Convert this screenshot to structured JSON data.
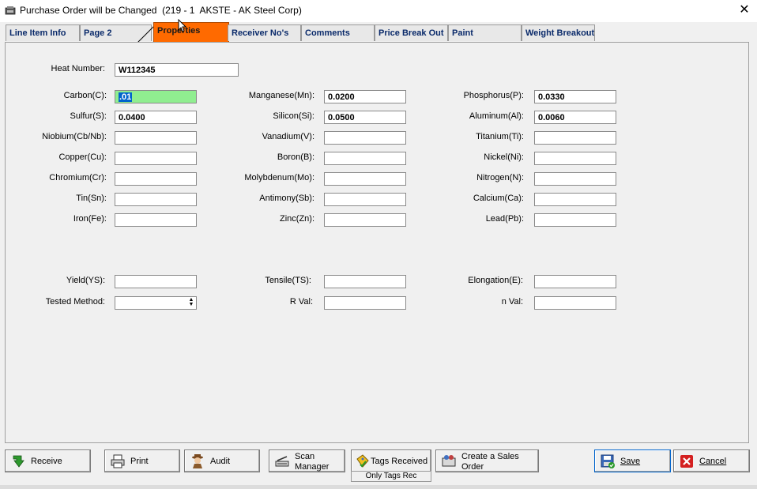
{
  "window": {
    "title": "Purchase Order will be Changed  (219 - 1  AKSTE - AK Steel Corp)",
    "close_glyph": "✕"
  },
  "tabs": [
    {
      "label": "Line Item Info",
      "active": false
    },
    {
      "label": "Page 2",
      "active": false
    },
    {
      "label": "Properties",
      "active": true
    },
    {
      "label": "Receiver No's",
      "active": false
    },
    {
      "label": "Comments",
      "active": false
    },
    {
      "label": "Price Break Out",
      "active": false
    },
    {
      "label": "Paint",
      "active": false
    },
    {
      "label": "Weight Breakout",
      "active": false
    }
  ],
  "heat": {
    "label": "Heat Number:",
    "value": "W112345"
  },
  "elements": {
    "col1": [
      {
        "label": "Carbon(C):",
        "value": ".01"
      },
      {
        "label": "Sulfur(S):",
        "value": "0.0400"
      },
      {
        "label": "Niobium(Cb/Nb):",
        "value": ""
      },
      {
        "label": "Copper(Cu):",
        "value": ""
      },
      {
        "label": "Chromium(Cr):",
        "value": ""
      },
      {
        "label": "Tin(Sn):",
        "value": ""
      },
      {
        "label": "Iron(Fe):",
        "value": ""
      }
    ],
    "col2": [
      {
        "label": "Manganese(Mn):",
        "value": "0.0200"
      },
      {
        "label": "Silicon(Si):",
        "value": "0.0500"
      },
      {
        "label": "Vanadium(V):",
        "value": ""
      },
      {
        "label": "Boron(B):",
        "value": ""
      },
      {
        "label": "Molybdenum(Mo):",
        "value": ""
      },
      {
        "label": "Antimony(Sb):",
        "value": ""
      },
      {
        "label": "Zinc(Zn):",
        "value": ""
      }
    ],
    "col3": [
      {
        "label": "Phosphorus(P):",
        "value": "0.0330"
      },
      {
        "label": "Aluminum(Al):",
        "value": "0.0060"
      },
      {
        "label": "Titanium(Ti):",
        "value": ""
      },
      {
        "label": "Nickel(Ni):",
        "value": ""
      },
      {
        "label": "Nitrogen(N):",
        "value": ""
      },
      {
        "label": "Calcium(Ca):",
        "value": ""
      },
      {
        "label": "Lead(Pb):",
        "value": ""
      }
    ]
  },
  "mechanical": {
    "yield": {
      "label": "Yield(YS):",
      "value": ""
    },
    "tensile": {
      "label": "Tensile(TS):",
      "value": ""
    },
    "elongation": {
      "label": "Elongation(E):",
      "value": ""
    },
    "tested_method": {
      "label": "Tested Method:",
      "value": ""
    },
    "r_val": {
      "label": "R Val:",
      "value": ""
    },
    "n_val": {
      "label": "n Val:",
      "value": ""
    }
  },
  "buttons": {
    "receive": "Receive",
    "print": "Print",
    "audit": "Audit",
    "scan_manager": [
      "Scan",
      "Manager"
    ],
    "tags_received": "Tags Received",
    "only_tags_rec": "Only Tags Rec",
    "create_sales_order": [
      "Create a Sales",
      "Order"
    ],
    "save": "Save",
    "cancel": "Cancel"
  },
  "icons": {
    "receive": "green-arrow-icon",
    "print": "printer-icon",
    "audit": "auditor-icon",
    "scan_manager": "scanner-icon",
    "tags_received": "tag-icon",
    "create_sales_order": "sales-order-icon",
    "save": "floppy-disk-icon",
    "cancel": "red-x-icon"
  },
  "colors": {
    "active_tab": "#ff6a00",
    "tab_text": "#0a2a6a",
    "focused_field": "#90ee90",
    "selection": "#0063cc"
  }
}
